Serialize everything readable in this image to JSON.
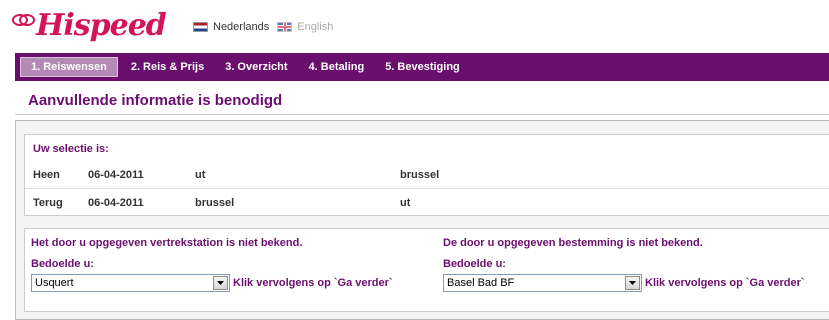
{
  "header": {
    "logo_text": "Hispeed",
    "brand_color": "#d4145a",
    "languages": [
      {
        "label": "Nederlands",
        "icon": "dutch-flag-icon",
        "active": true
      },
      {
        "label": "English",
        "icon": "uk-flag-icon",
        "active": false
      }
    ]
  },
  "steps": [
    {
      "label": "1. Reiswensen",
      "active": true
    },
    {
      "label": "2. Reis & Prijs",
      "active": false
    },
    {
      "label": "3. Overzicht",
      "active": false
    },
    {
      "label": "4. Betaling",
      "active": false
    },
    {
      "label": "5. Bevestiging",
      "active": false
    }
  ],
  "accent_color": "#6b0f6e",
  "page_title": "Aanvullende informatie is benodigd",
  "selection": {
    "title": "Uw selectie is:",
    "rows": [
      {
        "direction": "Heen",
        "date": "06-04-2011",
        "from": "ut",
        "to": "brussel"
      },
      {
        "direction": "Terug",
        "date": "06-04-2011",
        "from": "brussel",
        "to": "ut"
      }
    ]
  },
  "departure": {
    "message": "Het door u opgegeven vertrekstation is niet bekend.",
    "meant_label": "Bedoelde u:",
    "selected": "Usquert",
    "hint": "Klik vervolgens op `Ga verder`"
  },
  "destination": {
    "message": "De door u opgegeven bestemming is niet bekend.",
    "meant_label": "Bedoelde u:",
    "selected": "Basel Bad BF",
    "hint": "Klik vervolgens op `Ga verder`"
  }
}
